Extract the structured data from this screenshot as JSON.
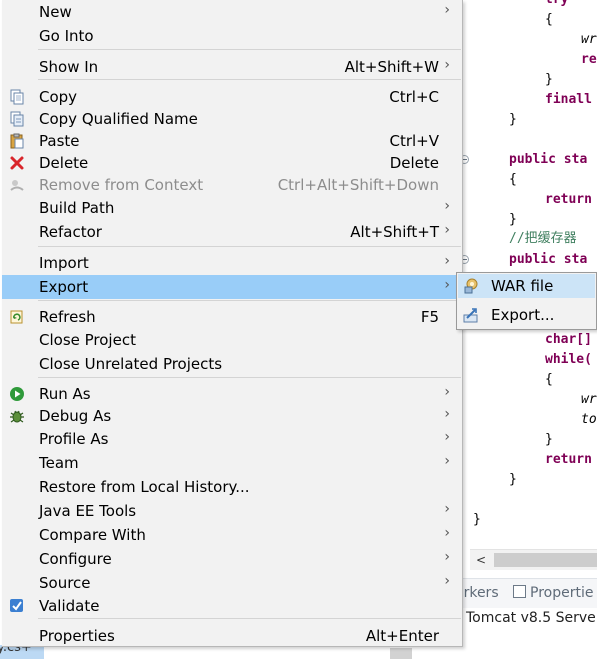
{
  "editor": {
    "code_lines": [
      {
        "text": "try"
      },
      {
        "text": "{"
      },
      {
        "text": "wr"
      },
      {
        "text": "re"
      },
      {
        "text": "}"
      },
      {
        "text": "finall"
      },
      {
        "text": "}"
      },
      {
        "text": "public sta"
      },
      {
        "text": "{"
      },
      {
        "text": "return"
      },
      {
        "text": "}"
      },
      {
        "text": "//把缓存器"
      },
      {
        "text": "public sta"
      },
      {
        "text": "char[]"
      },
      {
        "text": "while("
      },
      {
        "text": "{"
      },
      {
        "text": "wr"
      },
      {
        "text": "to"
      },
      {
        "text": "}"
      },
      {
        "text": "return"
      },
      {
        "text": "}"
      },
      {
        "text": "}"
      }
    ],
    "scroll_left_arrow": "<"
  },
  "views_bar": {
    "markers_tab": "arkers",
    "properties_tab": "Propertie"
  },
  "servers": {
    "row": "Tomcat v8.5 Serve"
  },
  "bottom_left_fragment": "y.cs+",
  "context_menu": {
    "items": [
      {
        "label": "New",
        "shortcut": "",
        "submenu": true,
        "icon": ""
      },
      {
        "label": "Go Into",
        "shortcut": "",
        "submenu": false,
        "icon": ""
      },
      {
        "label": "Show In",
        "shortcut": "Alt+Shift+W",
        "submenu": true,
        "icon": ""
      },
      {
        "label": "Copy",
        "shortcut": "Ctrl+C",
        "submenu": false,
        "icon": "copy-icon"
      },
      {
        "label": "Copy Qualified Name",
        "shortcut": "",
        "submenu": false,
        "icon": "copy-qualified-name-icon"
      },
      {
        "label": "Paste",
        "shortcut": "Ctrl+V",
        "submenu": false,
        "icon": "paste-icon"
      },
      {
        "label": "Delete",
        "shortcut": "Delete",
        "submenu": false,
        "icon": "delete-icon"
      },
      {
        "label": "Remove from Context",
        "shortcut": "Ctrl+Alt+Shift+Down",
        "submenu": false,
        "icon": "remove-context-icon",
        "disabled": true
      },
      {
        "label": "Build Path",
        "shortcut": "",
        "submenu": true,
        "icon": ""
      },
      {
        "label": "Refactor",
        "shortcut": "Alt+Shift+T",
        "submenu": true,
        "icon": ""
      },
      {
        "label": "Import",
        "shortcut": "",
        "submenu": true,
        "icon": ""
      },
      {
        "label": "Export",
        "shortcut": "",
        "submenu": true,
        "icon": "",
        "highlighted": true
      },
      {
        "label": "Refresh",
        "shortcut": "F5",
        "submenu": false,
        "icon": "refresh-icon"
      },
      {
        "label": "Close Project",
        "shortcut": "",
        "submenu": false,
        "icon": ""
      },
      {
        "label": "Close Unrelated Projects",
        "shortcut": "",
        "submenu": false,
        "icon": ""
      },
      {
        "label": "Run As",
        "shortcut": "",
        "submenu": true,
        "icon": "run-icon"
      },
      {
        "label": "Debug As",
        "shortcut": "",
        "submenu": true,
        "icon": "debug-icon"
      },
      {
        "label": "Profile As",
        "shortcut": "",
        "submenu": true,
        "icon": ""
      },
      {
        "label": "Team",
        "shortcut": "",
        "submenu": true,
        "icon": ""
      },
      {
        "label": "Restore from Local History...",
        "shortcut": "",
        "submenu": false,
        "icon": ""
      },
      {
        "label": "Java EE Tools",
        "shortcut": "",
        "submenu": true,
        "icon": ""
      },
      {
        "label": "Compare With",
        "shortcut": "",
        "submenu": true,
        "icon": ""
      },
      {
        "label": "Configure",
        "shortcut": "",
        "submenu": true,
        "icon": ""
      },
      {
        "label": "Source",
        "shortcut": "",
        "submenu": true,
        "icon": ""
      },
      {
        "label": "Validate",
        "shortcut": "",
        "submenu": false,
        "icon": "validate-check-icon"
      },
      {
        "label": "Properties",
        "shortcut": "Alt+Enter",
        "submenu": false,
        "icon": ""
      }
    ]
  },
  "export_submenu": {
    "items": [
      {
        "label": "WAR file",
        "icon": "war-file-icon",
        "highlighted": true
      },
      {
        "label": "Export...",
        "icon": "export-wizard-icon"
      }
    ]
  },
  "colors": {
    "menu_background": "#f2f2f2",
    "highlight": "#99cdf8",
    "keyword": "#7f0055",
    "comment": "#3f7f5f"
  }
}
